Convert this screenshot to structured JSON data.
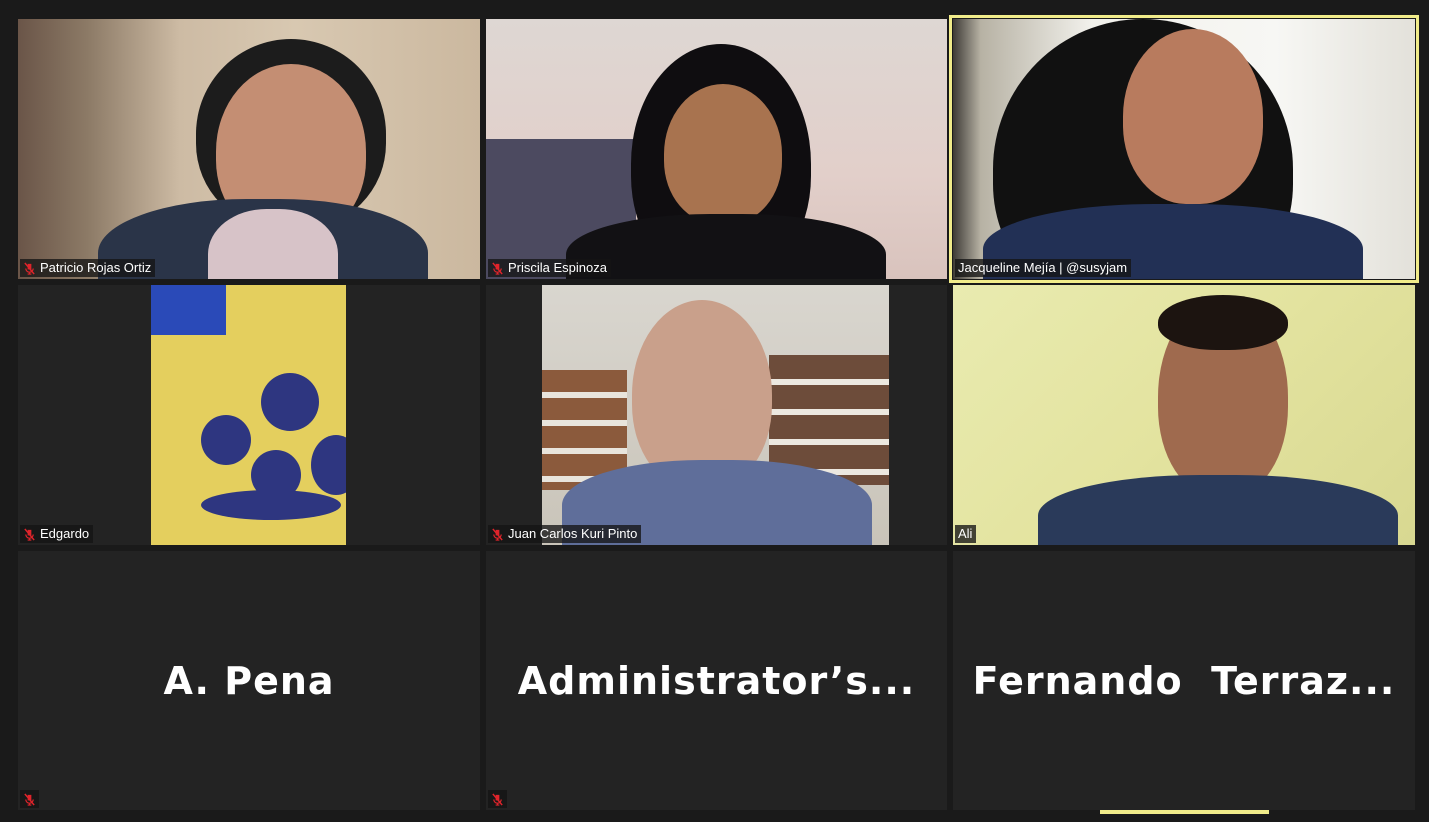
{
  "participants": [
    {
      "name": "Patricio Rojas Ortiz",
      "muted": true,
      "video": true
    },
    {
      "name": "Priscila Espinoza",
      "muted": true,
      "video": true
    },
    {
      "name": "Jacqueline Mejía | @susyjam",
      "muted": false,
      "video": true,
      "speaking": true
    },
    {
      "name": "Edgardo",
      "muted": true,
      "video": true
    },
    {
      "name": "Juan Carlos Kuri Pinto",
      "muted": true,
      "video": true
    },
    {
      "name": "Ali",
      "muted": false,
      "video": true
    },
    {
      "name": "A. Pena",
      "muted": true,
      "video": false
    },
    {
      "name": "Administrator’s...",
      "muted": true,
      "video": false
    },
    {
      "name": "Fernando  Terraz...",
      "muted": false,
      "video": false
    }
  ],
  "icons": {
    "mute": "mic-muted-icon"
  },
  "colors": {
    "speaking_highlight": "#f1ec8a",
    "tile_bg": "#232323",
    "mute_red": "#e0242b"
  }
}
